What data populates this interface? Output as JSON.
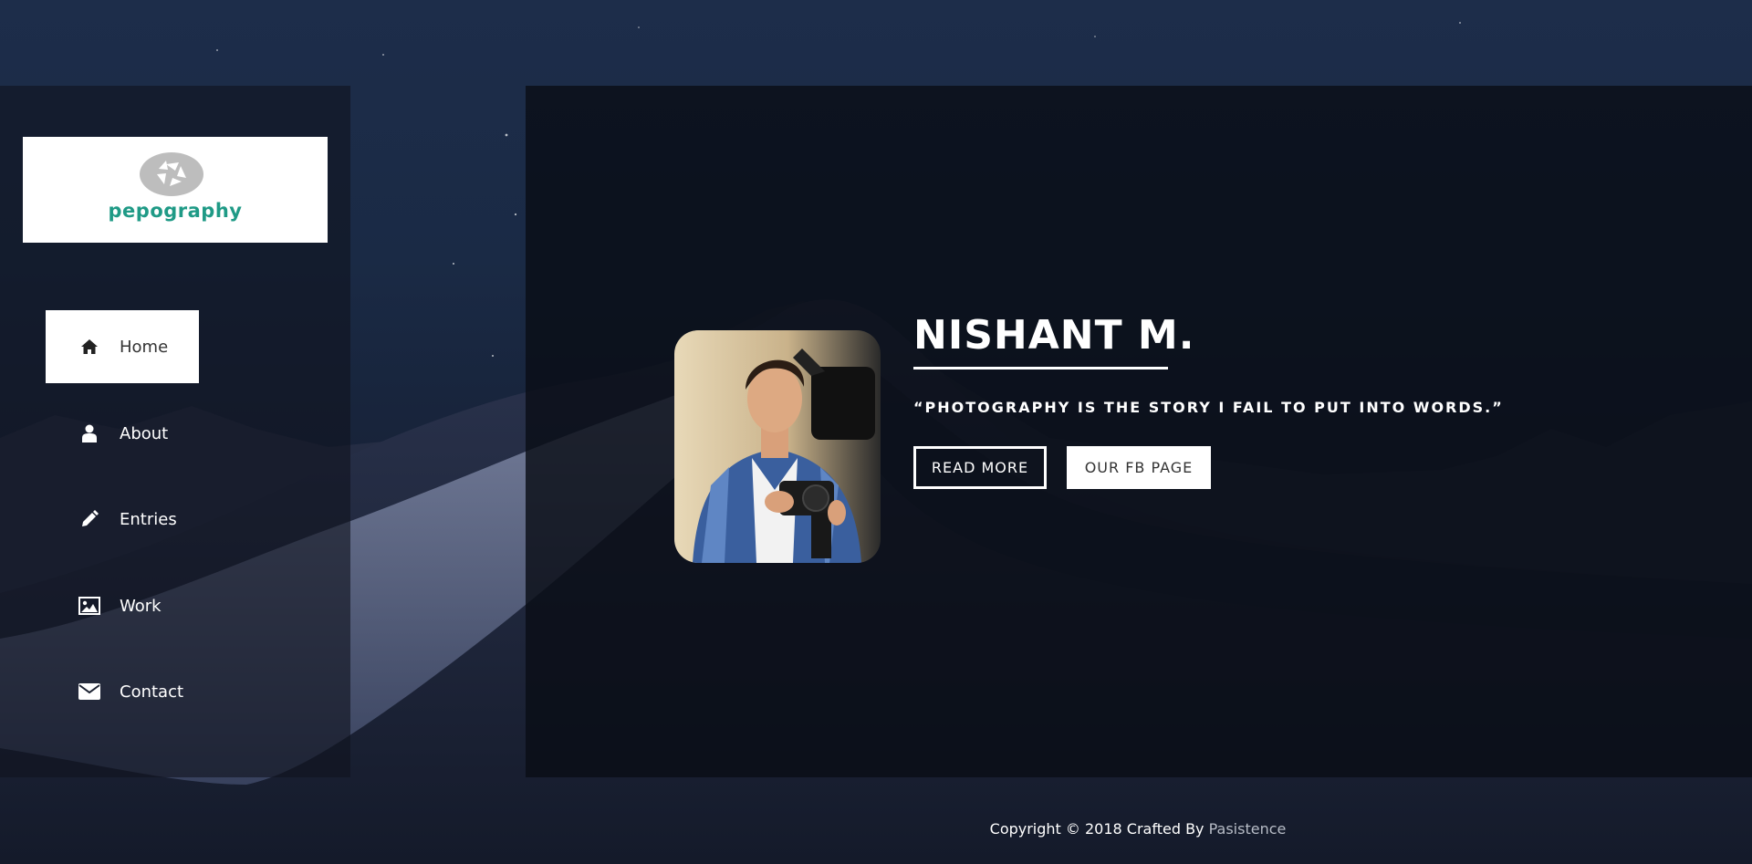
{
  "brand": {
    "logo_text": "pepography",
    "logo_icon": "aperture-icon",
    "accent_color": "#1f9a86"
  },
  "sidebar": {
    "items": [
      {
        "label": "Home",
        "icon": "home-icon",
        "active": true
      },
      {
        "label": "About",
        "icon": "user-icon",
        "active": false
      },
      {
        "label": "Entries",
        "icon": "pencil-icon",
        "active": false
      },
      {
        "label": "Work",
        "icon": "image-icon",
        "active": false
      },
      {
        "label": "Contact",
        "icon": "envelope-icon",
        "active": false
      }
    ]
  },
  "hero": {
    "name": "NISHANT M.",
    "quote": "“PHOTOGRAPHY IS THE STORY I FAIL TO PUT INTO WORDS.”",
    "read_more_label": "READ MORE",
    "fb_label": "OUR FB PAGE"
  },
  "footer": {
    "copyright": "Copyright © 2018 Crafted By",
    "author_link": "Pasistence"
  }
}
